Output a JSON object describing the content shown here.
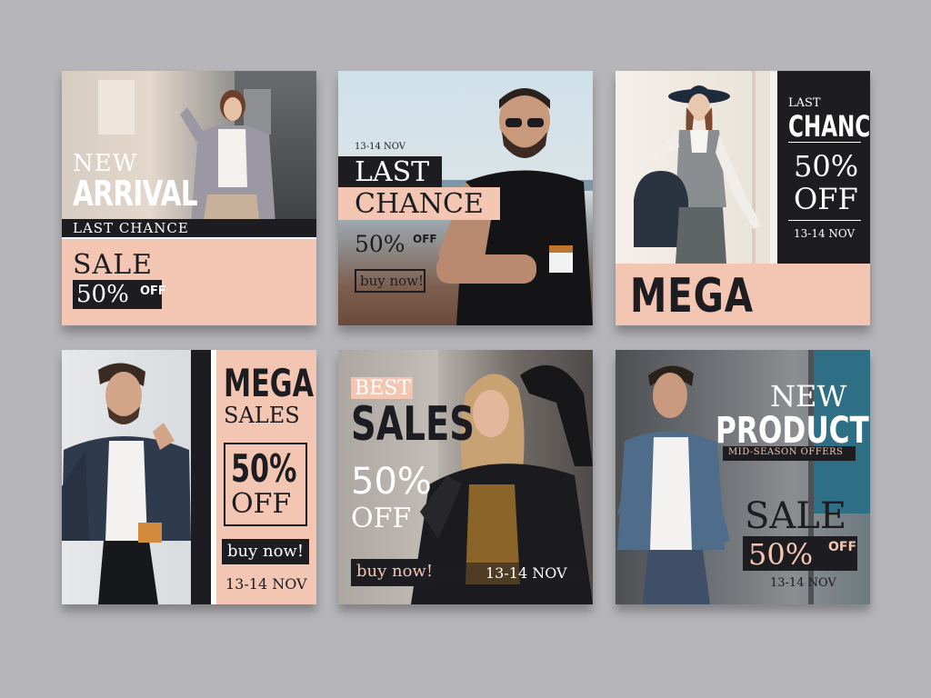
{
  "colors": {
    "background": "#b6b5b9",
    "accent_pink": "#f2c6b2",
    "accent_dark": "#1d1c21",
    "white": "#ffffff"
  },
  "posts": [
    {
      "line1": "NEW",
      "line2": "ARRIVAL",
      "line3": "LAST CHANCE",
      "sale": "SALE",
      "percent": "50%",
      "off": "OFF",
      "photo": "woman-plaid-blazer-photo"
    },
    {
      "date": "13-14 NOV",
      "line1": "LAST",
      "line2": "CHANCE",
      "percent": "50%",
      "off": "OFF",
      "button": "buy now!",
      "photo": "man-sunglasses-coffee-photo"
    },
    {
      "line1": "LAST",
      "line2": "CHANCE",
      "percent": "50%",
      "off": "OFF",
      "date": "13-14 NOV",
      "headline": "MEGA SALES",
      "photo": "woman-hat-handbag-photo"
    },
    {
      "line1": "MEGA",
      "line2": "SALES",
      "percent": "50%",
      "off": "OFF",
      "button": "buy now!",
      "date": "13-14 NOV",
      "photo": "man-denim-jacket-photo"
    },
    {
      "line1": "BEST",
      "line2": "SALES",
      "percent": "50%",
      "off": "OFF",
      "button": "buy now!",
      "date": "13-14 NOV",
      "photo": "woman-leather-jacket-photo"
    },
    {
      "line1": "NEW",
      "line2": "PRODUCTS",
      "line3": "MID-SEASON OFFERS",
      "sale": "SALE",
      "percent": "50%",
      "off": "OFF",
      "date": "13-14 NOV",
      "photo": "man-jeans-jacket-photo"
    }
  ]
}
